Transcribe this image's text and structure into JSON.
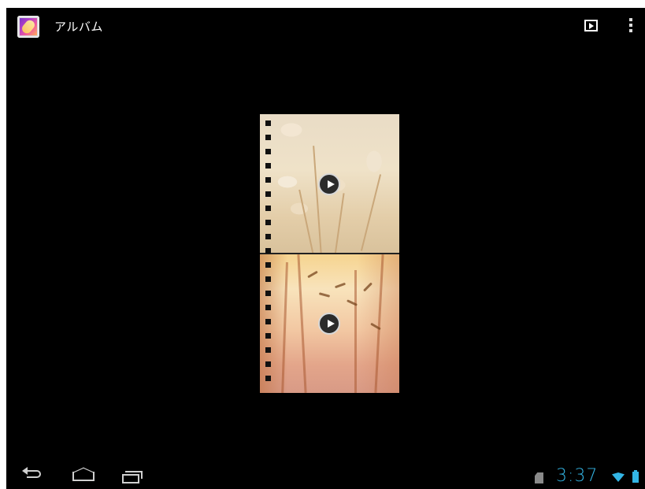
{
  "action_bar": {
    "title": "アルバム",
    "app_icon": "gallery-icon",
    "slideshow_icon": "play-icon",
    "overflow_icon": "overflow-menu-icon"
  },
  "album": {
    "items": [
      {
        "type": "video",
        "thumbnail": "bunny-tail-grass-thumbnail",
        "overlay_icon": "play-icon"
      },
      {
        "type": "video",
        "thumbnail": "wheat-grass-thumbnail",
        "overlay_icon": "play-icon"
      }
    ]
  },
  "system_bar": {
    "nav_icons": [
      "back-icon",
      "home-icon",
      "recent-apps-icon"
    ],
    "time": "3:37",
    "status_icons": [
      "sd-card-icon",
      "wifi-icon",
      "battery-icon"
    ],
    "accent_color": "#33b5e5"
  }
}
